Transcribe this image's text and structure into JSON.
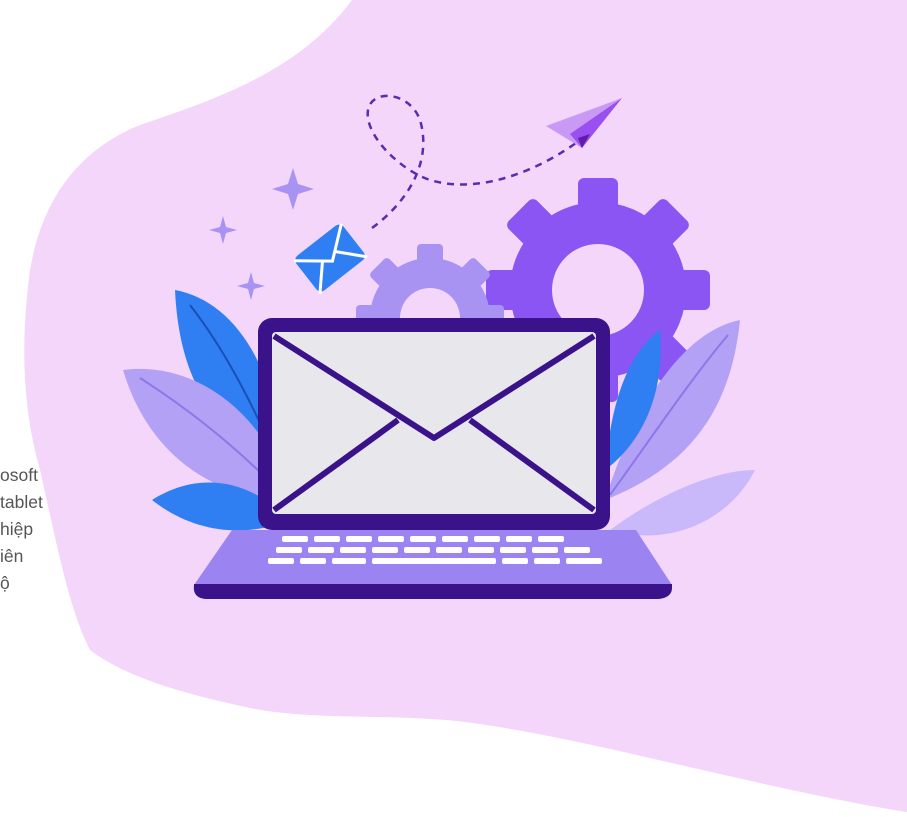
{
  "paragraph_fragments": [
    "osoft",
    "tablet",
    "hiệp",
    "iên",
    "ộ"
  ],
  "colors": {
    "blob": "#f4d6fa",
    "gear_large": "#8a55f2",
    "gear_small": "#a893f2",
    "leaf_blue": "#2f7ff3",
    "leaf_lavender": "#b3a1f6",
    "laptop_frame": "#3a138a",
    "screen": "#e8e8ec",
    "base": "#9b84f2",
    "envelope_small": "#2f7ff3",
    "sparkle": "#a893f2"
  },
  "icons": [
    "paper-plane-icon",
    "gear-icon",
    "envelope-icon",
    "sparkle-icon",
    "laptop-icon"
  ]
}
